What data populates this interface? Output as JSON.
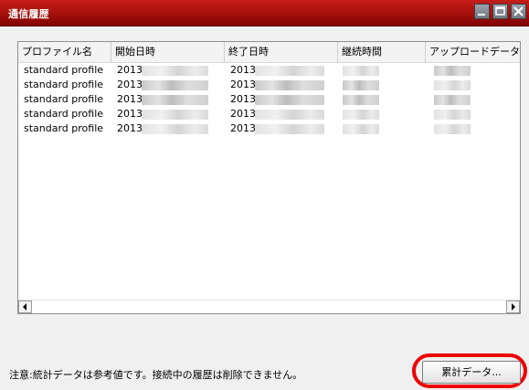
{
  "window": {
    "title": "通信履歴",
    "controls": {
      "minimize": "minimize",
      "maximize": "maximize",
      "close": "close"
    },
    "titlebar_color": "#a40f0c"
  },
  "table": {
    "columns": [
      "プロファイル名",
      "開始日時",
      "終了日時",
      "継続時間",
      "アップロードデータ"
    ],
    "rows": [
      {
        "profile": "standard profile",
        "start": "2013",
        "end": "2013"
      },
      {
        "profile": "standard profile",
        "start": "2013",
        "end": "2013"
      },
      {
        "profile": "standard profile",
        "start": "2013",
        "end": "2013"
      },
      {
        "profile": "standard profile",
        "start": "2013",
        "end": "2013"
      },
      {
        "profile": "standard profile",
        "start": "2013",
        "end": "2013"
      }
    ]
  },
  "footer": {
    "note": "注意:統計データは参考値です。接続中の履歴は削除できません。",
    "summary_button": "累計データ..."
  },
  "highlight_color": "#ee0000"
}
